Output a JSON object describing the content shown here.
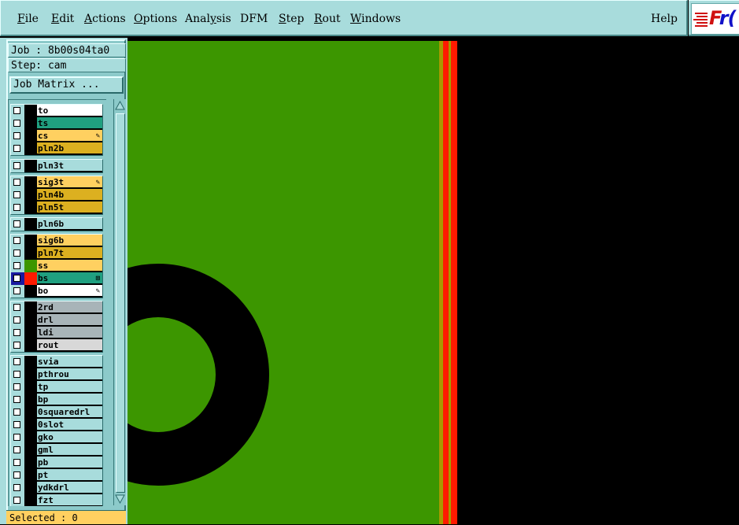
{
  "menu": {
    "items": [
      {
        "pre": "",
        "u": "F",
        "post": "ile"
      },
      {
        "pre": "",
        "u": "E",
        "post": "dit"
      },
      {
        "pre": "",
        "u": "A",
        "post": "ctions"
      },
      {
        "pre": "",
        "u": "O",
        "post": "ptions"
      },
      {
        "pre": "Anal",
        "u": "y",
        "post": "sis"
      },
      {
        "pre": "DFM",
        "u": "",
        "post": ""
      },
      {
        "pre": "",
        "u": "S",
        "post": "tep"
      },
      {
        "pre": "",
        "u": "R",
        "post": "out"
      },
      {
        "pre": "",
        "u": "W",
        "post": "indows"
      }
    ],
    "help": "Help"
  },
  "logo": {
    "text_red": "F",
    "text_blue": "r("
  },
  "job": {
    "line": "Job : 8b00s04ta0"
  },
  "step": {
    "line": "Step: cam"
  },
  "job_matrix": {
    "label": "Job Matrix ..."
  },
  "colors": {
    "white": "#ffffff",
    "teal": "#20a080",
    "yellow": "#ffd060",
    "gold": "#dcb020",
    "cyan": "#a8dcdc",
    "grey": "#a8b4b8",
    "lightgrey": "#d8d8d8",
    "board_green": "#3c9600",
    "accent_red": "#ff1a00",
    "olive": "#a89a00"
  },
  "layer_groups": [
    [
      {
        "name": "to",
        "color": "white",
        "mark": ""
      },
      {
        "name": "ts",
        "color": "teal",
        "mark": ""
      },
      {
        "name": "cs",
        "color": "yellow",
        "mark": "pencil"
      },
      {
        "name": "pln2b",
        "color": "gold",
        "mark": ""
      }
    ],
    [
      {
        "name": "pln3t",
        "color": "cyan",
        "mark": ""
      }
    ],
    [
      {
        "name": "sig3t",
        "color": "yellow",
        "mark": "pencil"
      },
      {
        "name": "pln4b",
        "color": "gold",
        "mark": ""
      },
      {
        "name": "pln5t",
        "color": "gold",
        "mark": ""
      }
    ],
    [
      {
        "name": "pln6b",
        "color": "cyan",
        "mark": ""
      }
    ],
    [
      {
        "name": "sig6b",
        "color": "yellow",
        "mark": ""
      },
      {
        "name": "pln7t",
        "color": "gold",
        "mark": ""
      },
      {
        "name": "ss",
        "color": "yellow",
        "mark": "",
        "swatch": "#3c9600"
      },
      {
        "name": "bs",
        "color": "teal",
        "mark": "grid",
        "swatch": "#ff1a00",
        "checked": true
      },
      {
        "name": "bo",
        "color": "white",
        "mark": "pencil"
      }
    ],
    [
      {
        "name": "2rd",
        "color": "grey",
        "mark": ""
      },
      {
        "name": "drl",
        "color": "grey",
        "mark": ""
      },
      {
        "name": "ldi",
        "color": "grey",
        "mark": ""
      },
      {
        "name": "rout",
        "color": "lightgrey",
        "mark": ""
      }
    ],
    [
      {
        "name": "svia",
        "color": "cyan",
        "mark": ""
      },
      {
        "name": "pthrou",
        "color": "cyan",
        "mark": ""
      },
      {
        "name": "tp",
        "color": "cyan",
        "mark": ""
      },
      {
        "name": "bp",
        "color": "cyan",
        "mark": ""
      },
      {
        "name": "0squaredrl",
        "color": "cyan",
        "mark": ""
      },
      {
        "name": "0slot",
        "color": "cyan",
        "mark": ""
      },
      {
        "name": "gko",
        "color": "cyan",
        "mark": ""
      },
      {
        "name": "gml",
        "color": "cyan",
        "mark": ""
      },
      {
        "name": "pb",
        "color": "cyan",
        "mark": ""
      },
      {
        "name": "pt",
        "color": "cyan",
        "mark": ""
      },
      {
        "name": "ydkdrl",
        "color": "cyan",
        "mark": ""
      },
      {
        "name": "fzt",
        "color": "cyan",
        "mark": ""
      }
    ]
  ],
  "status": {
    "selected": "Selected : 0"
  }
}
